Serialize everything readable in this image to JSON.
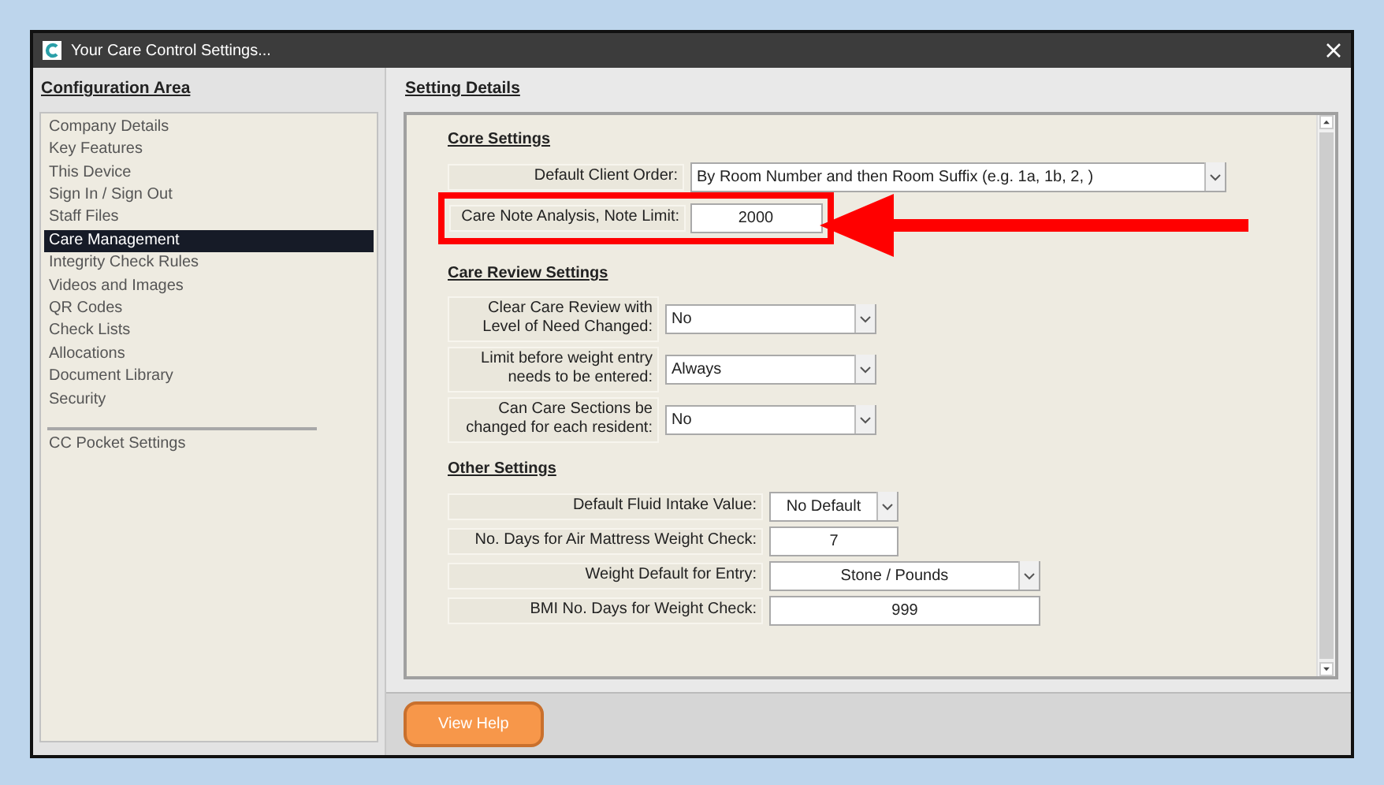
{
  "window": {
    "title": "Your Care Control Settings..."
  },
  "sidebar": {
    "title": "Configuration Area",
    "items": [
      {
        "label": "Company Details",
        "selected": false
      },
      {
        "label": "Key Features",
        "selected": false
      },
      {
        "label": "This Device",
        "selected": false
      },
      {
        "label": "Sign In / Sign Out",
        "selected": false
      },
      {
        "label": "Staff Files",
        "selected": false
      },
      {
        "label": "Care Management",
        "selected": true
      },
      {
        "label": "Integrity Check Rules",
        "selected": false
      },
      {
        "label": "Videos and Images",
        "selected": false
      },
      {
        "label": "QR Codes",
        "selected": false
      },
      {
        "label": "Check Lists",
        "selected": false
      },
      {
        "label": "Allocations",
        "selected": false
      },
      {
        "label": "Document Library",
        "selected": false
      },
      {
        "label": "Security",
        "selected": false
      }
    ],
    "extra_items": [
      {
        "label": "CC Pocket Settings",
        "selected": false
      }
    ]
  },
  "details": {
    "title": "Setting Details",
    "sections": [
      {
        "heading": "Core Settings",
        "rows": [
          {
            "label": "Default Client Order:",
            "kind": "dropdown",
            "value": "By Room Number and then Room Suffix (e.g. 1a, 1b, 2, )",
            "highlighted": false
          },
          {
            "label": "Care Note Analysis, Note Limit:",
            "kind": "number",
            "value": "2000",
            "highlighted": true
          }
        ]
      },
      {
        "heading": "Care Review Settings",
        "rows": [
          {
            "label": "Clear Care Review with Level of Need Changed:",
            "kind": "dropdown",
            "value": "No",
            "highlighted": false
          },
          {
            "label": "Limit before weight entry needs to be entered:",
            "kind": "dropdown",
            "value": "Always",
            "highlighted": false
          },
          {
            "label": "Can Care Sections be changed for each resident:",
            "kind": "dropdown",
            "value": "No",
            "highlighted": false
          }
        ]
      },
      {
        "heading": "Other Settings",
        "rows": [
          {
            "label": "Default Fluid Intake Value:",
            "kind": "dropdown",
            "value": "No Default",
            "highlighted": false
          },
          {
            "label": "No. Days for Air Mattress Weight Check:",
            "kind": "number",
            "value": "7",
            "highlighted": false
          },
          {
            "label": "Weight Default for Entry:",
            "kind": "dropdown",
            "value": "Stone / Pounds",
            "highlighted": false
          },
          {
            "label": "BMI No. Days for Weight Check:",
            "kind": "number",
            "value": "999",
            "highlighted": false
          }
        ]
      }
    ]
  },
  "footer": {
    "button": "View Help"
  }
}
